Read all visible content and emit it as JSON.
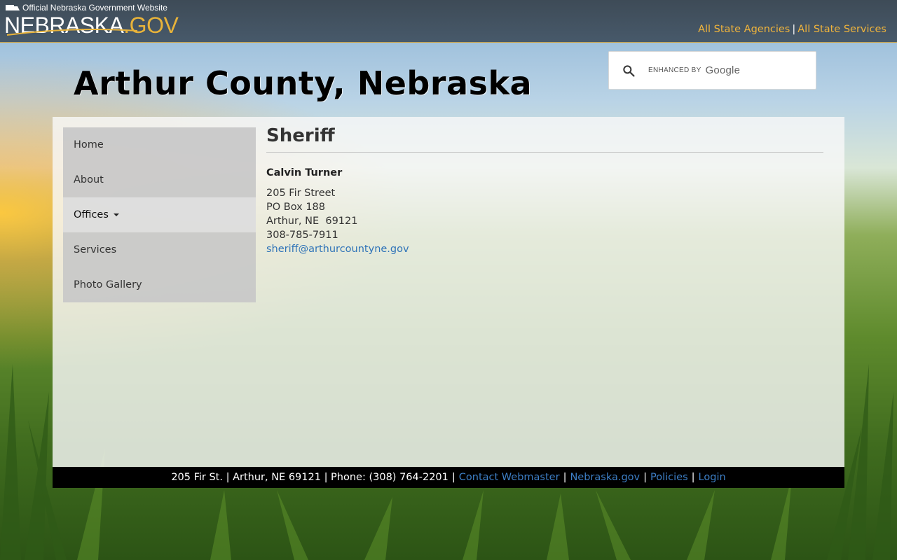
{
  "header": {
    "official_text": "Official Nebraska Government Website",
    "logo_word": "NEBRASKA",
    "logo_dot": ".",
    "logo_gov": "GOV",
    "links": [
      "All State Agencies",
      "All State Services"
    ],
    "link_separator": "|"
  },
  "site": {
    "title": "Arthur County, Nebraska"
  },
  "search": {
    "enhanced_by": "ENHANCED BY",
    "google": "Google",
    "icon": "search-icon"
  },
  "nav": {
    "items": [
      {
        "label": "Home"
      },
      {
        "label": "About"
      },
      {
        "label": "Offices"
      },
      {
        "label": "Services"
      },
      {
        "label": "Photo Gallery"
      }
    ]
  },
  "content": {
    "heading": "Sheriff",
    "name": "Calvin Turner",
    "address1": "205 Fir Street",
    "address2": "PO Box 188",
    "city": "Arthur, NE  69121",
    "phone": "308-785-7911",
    "email": "sheriff@arthurcountyne.gov"
  },
  "footer": {
    "address": "205 Fir St. | Arthur, NE 69121 | Phone: (308) 764-2201",
    "links": [
      "Contact Webmaster",
      "Nebraska.gov",
      "Policies",
      "Login"
    ],
    "separator": "|"
  },
  "colors": {
    "accent_gold": "#e8b33a",
    "link_blue": "#2f73b8",
    "topbar": "#47596a"
  }
}
